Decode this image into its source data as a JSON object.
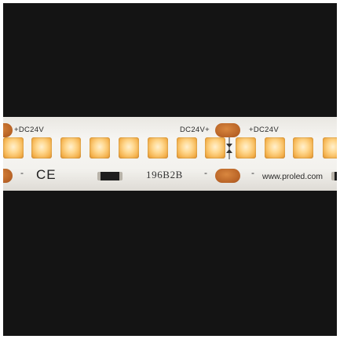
{
  "strip": {
    "label_left": "+DC24V",
    "label_center": "DC24V+",
    "label_right": "+DC24V",
    "ce_mark": "CE",
    "product_code": "196B2B",
    "url": "www.proled.com",
    "minus_signs": [
      "-",
      "-",
      "-"
    ]
  },
  "colors": {
    "background": "#141414",
    "pcb": "#f3f2ee",
    "led": "#ffd88f",
    "solder_pad": "#b86326"
  }
}
